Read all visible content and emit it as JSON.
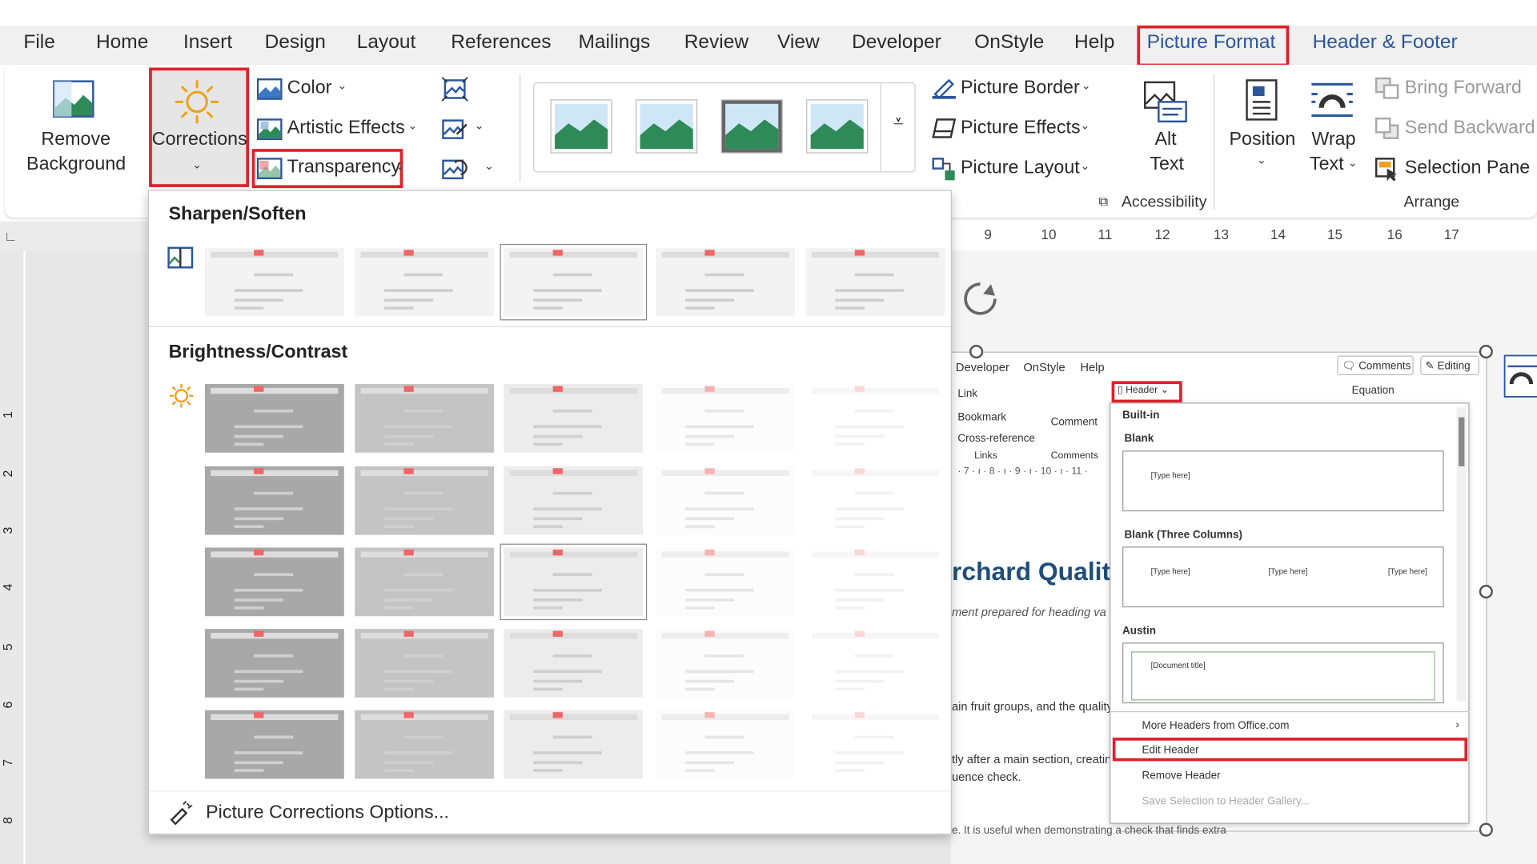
{
  "ribbon_tabs": [
    "File",
    "Home",
    "Insert",
    "Design",
    "Layout",
    "References",
    "Mailings",
    "Review",
    "View",
    "Developer",
    "OnStyle",
    "Help",
    "Picture Format",
    "Header & Footer"
  ],
  "ribbon": {
    "remove_background": [
      "Remove",
      "Background"
    ],
    "corrections": "Corrections",
    "color": "Color",
    "artistic_effects": "Artistic Effects",
    "transparency": "Transparency",
    "picture_border": "Picture Border",
    "picture_effects": "Picture Effects",
    "picture_layout": "Picture Layout",
    "alt_text": [
      "Alt",
      "Text"
    ],
    "accessibility": "Accessibility",
    "position": "Position",
    "wrap_text": [
      "Wrap",
      "Text"
    ],
    "bring_forward": "Bring Forward",
    "send_backward": "Send Backward",
    "selection_pane": "Selection Pane",
    "arrange": "Arrange"
  },
  "ruler_numbers": [
    "9",
    "10",
    "11",
    "12",
    "13",
    "14",
    "15",
    "16",
    "17"
  ],
  "vruler_numbers": [
    "1",
    "2",
    "3",
    "4",
    "5",
    "6",
    "7",
    "8"
  ],
  "corrections_menu": {
    "sharpen_title": "Sharpen/Soften",
    "brightness_title": "Brightness/Contrast",
    "options": "Picture Corrections Options...",
    "sharpen_selected_index": 2,
    "brightness_selected": [
      2,
      2
    ]
  },
  "embedded": {
    "tabs": [
      "Developer",
      "OnStyle",
      "Help"
    ],
    "comments": "Comments",
    "editing": "Editing",
    "header_button": "Header",
    "equation": "Equation",
    "link": "Link",
    "bookmark": "Bookmark",
    "cross_reference": "Cross-reference",
    "links": "Links",
    "comment": "Comment",
    "comments_group": "Comments",
    "ruler": "· 7 · ı · 8 · ı · 9 · ı · 10 · ı · 11 ·",
    "doc_title": "rchard Quality",
    "doc_sub": "ment prepared for heading va",
    "doc_line1": "ain fruit groups, and the quality",
    "doc_line2": "tly after a main section, creatin",
    "doc_line3": "uence check.",
    "doc_line4": "e. It is useful when demonstrating a check that finds extra",
    "gallery": {
      "builtin": "Built-in",
      "blank": "Blank",
      "type_here": "[Type here]",
      "blank_three": "Blank (Three Columns)",
      "austin": "Austin",
      "doc_title": "[Document title]",
      "more_headers": "More Headers from Office.com",
      "edit_header": "Edit Header",
      "remove_header": "Remove Header",
      "save_selection": "Save Selection to Header Gallery..."
    }
  },
  "colors": {
    "accent": "#2b579a",
    "highlight": "#e0202a",
    "sun": "#f0a020"
  }
}
